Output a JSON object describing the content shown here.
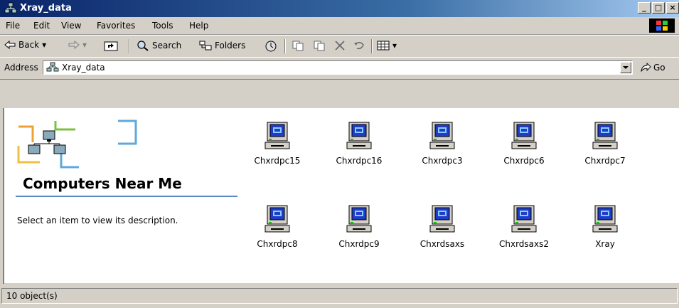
{
  "window": {
    "title": "Xray_data",
    "minimize": "_",
    "maximize": "□",
    "close": "×"
  },
  "menu": [
    "File",
    "Edit",
    "View",
    "Favorites",
    "Tools",
    "Help"
  ],
  "toolbar": {
    "back": "Back",
    "search": "Search",
    "folders": "Folders"
  },
  "address": {
    "label": "Address",
    "value": "Xray_data",
    "go": "Go"
  },
  "leftpane": {
    "title": "Computers Near Me",
    "description": "Select an item to view its description."
  },
  "items": [
    "Chxrdpc15",
    "Chxrdpc16",
    "Chxrdpc3",
    "Chxrdpc6",
    "Chxrdpc7",
    "Chxrdpc8",
    "Chxrdpc9",
    "Chxrdsaxs",
    "Chxrdsaxs2",
    "Xray"
  ],
  "status": {
    "text": "10 object(s)"
  },
  "colors": {
    "titlebar_start": "#0a246a",
    "accent_line": "#5a86c6",
    "chrome": "#d4d0c8"
  }
}
